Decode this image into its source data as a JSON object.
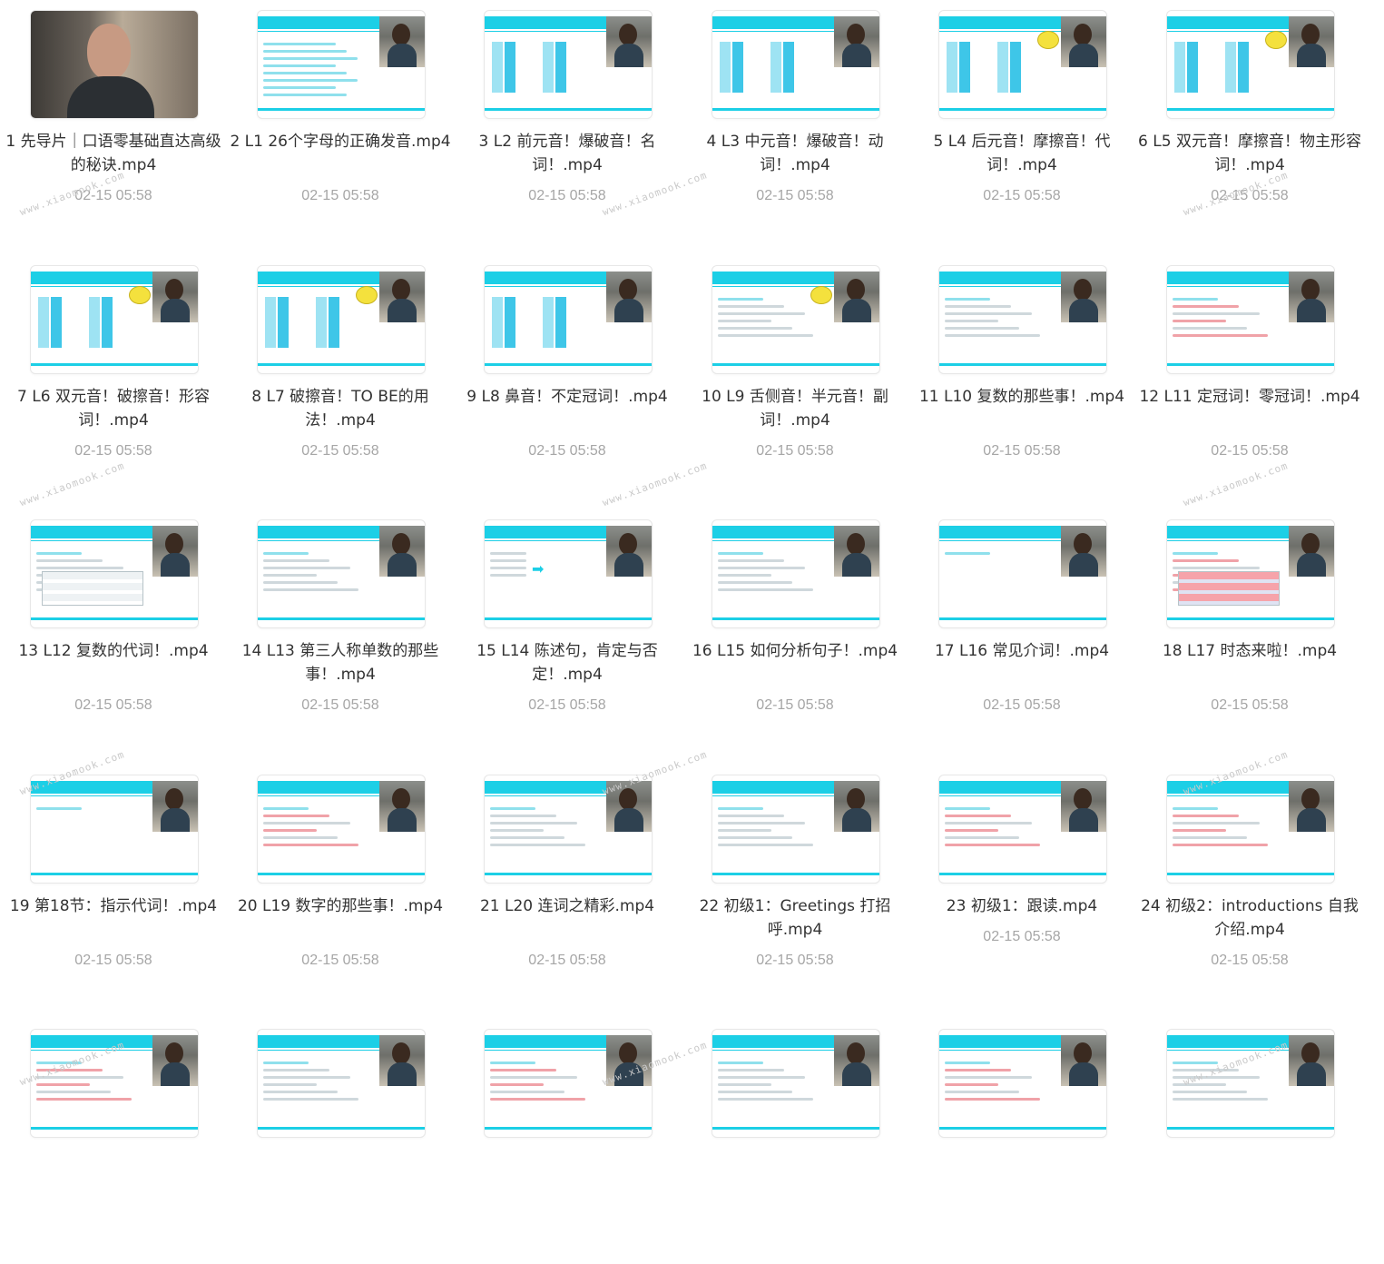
{
  "watermark_text": "www.xiaomook.com",
  "files": [
    {
      "name": "1 先导片｜口语零基础直达高级的秘诀.mp4",
      "date": "02-15 05:58",
      "thumb": "photo"
    },
    {
      "name": "2 L1 26个字母的正确发音.mp4",
      "date": "02-15 05:58",
      "thumb": "letters"
    },
    {
      "name": "3 L2 前元音！爆破音！名词！.mp4",
      "date": "02-15 05:58",
      "thumb": "cols"
    },
    {
      "name": "4 L3 中元音！爆破音！动词！.mp4",
      "date": "02-15 05:58",
      "thumb": "cols"
    },
    {
      "name": "5 L4 后元音！摩擦音！代词！.mp4",
      "date": "02-15 05:58",
      "thumb": "cols-badge"
    },
    {
      "name": "6 L5 双元音！摩擦音！物主形容词！.mp4",
      "date": "02-15 05:58",
      "thumb": "cols-badge"
    },
    {
      "name": "7 L6 双元音！破擦音！形容词！.mp4",
      "date": "02-15 05:58",
      "thumb": "cols-badge"
    },
    {
      "name": "8 L7 破擦音！TO BE的用法！.mp4",
      "date": "02-15 05:58",
      "thumb": "cols-badge"
    },
    {
      "name": "9 L8 鼻音！不定冠词！.mp4",
      "date": "02-15 05:58",
      "thumb": "cols"
    },
    {
      "name": "10 L9 舌侧音！半元音！副词！.mp4",
      "date": "02-15 05:58",
      "thumb": "practice-badge"
    },
    {
      "name": "11 L10 复数的那些事！.mp4",
      "date": "02-15 05:58",
      "thumb": "practice"
    },
    {
      "name": "12 L11 定冠词！零冠词！.mp4",
      "date": "02-15 05:58",
      "thumb": "text-red"
    },
    {
      "name": "13 L12 复数的代词！.mp4",
      "date": "02-15 05:58",
      "thumb": "table"
    },
    {
      "name": "14 L13 第三人称单数的那些事！.mp4",
      "date": "02-15 05:58",
      "thumb": "text"
    },
    {
      "name": "15 L14 陈述句，肯定与否定！.mp4",
      "date": "02-15 05:58",
      "thumb": "arrow"
    },
    {
      "name": "16 L15 如何分析句子！.mp4",
      "date": "02-15 05:58",
      "thumb": "text"
    },
    {
      "name": "17 L16 常见介词！.mp4",
      "date": "02-15 05:58",
      "thumb": "practice-empty"
    },
    {
      "name": "18 L17 时态来啦！.mp4",
      "date": "02-15 05:58",
      "thumb": "table-red"
    },
    {
      "name": "19 第18节：指示代词！.mp4",
      "date": "02-15 05:58",
      "thumb": "practice-empty"
    },
    {
      "name": "20 L19 数字的那些事！.mp4",
      "date": "02-15 05:58",
      "thumb": "text-red"
    },
    {
      "name": "21 L20 连词之精彩.mp4",
      "date": "02-15 05:58",
      "thumb": "practice"
    },
    {
      "name": "22 初级1：Greetings 打招呼.mp4",
      "date": "02-15 05:58",
      "thumb": "text"
    },
    {
      "name": "23 初级1：跟读.mp4",
      "date": "02-15 05:58",
      "thumb": "text-red"
    },
    {
      "name": "24 初级2：introductions 自我介绍.mp4",
      "date": "02-15 05:58",
      "thumb": "text-red"
    },
    {
      "name": "",
      "date": "",
      "thumb": "text-red"
    },
    {
      "name": "",
      "date": "",
      "thumb": "text"
    },
    {
      "name": "",
      "date": "",
      "thumb": "text-red"
    },
    {
      "name": "",
      "date": "",
      "thumb": "text"
    },
    {
      "name": "",
      "date": "",
      "thumb": "text-red"
    },
    {
      "name": "",
      "date": "",
      "thumb": "text"
    }
  ]
}
